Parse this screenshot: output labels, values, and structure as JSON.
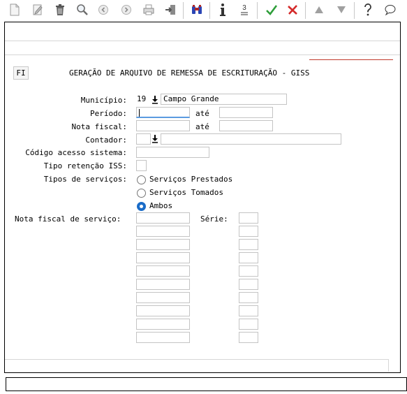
{
  "toolbar": {
    "icons": [
      "new-icon",
      "edit-icon",
      "trash-icon",
      "search-icon",
      "previous-icon",
      "next-icon",
      "print-icon",
      "exit-icon",
      "binoculars-icon",
      "info-icon",
      "list-number-icon",
      "confirm-icon",
      "cancel-icon",
      "first-icon",
      "last-icon",
      "help-icon",
      "chat-icon"
    ]
  },
  "form": {
    "mode": "FI",
    "title": "GERAÇÃO DE ARQUIVO DE REMESSA DE ESCRITURAÇÃO - GISS",
    "municipio_label": "Município:",
    "municipio_code": "19",
    "municipio_name": "Campo Grande",
    "periodo_label": "Período:",
    "periodo_from": "",
    "periodo_to": "",
    "ate_label": "até",
    "nota_label": "Nota fiscal:",
    "nota_from": "",
    "nota_to": "",
    "contador_label": "Contador:",
    "contador_code": "",
    "contador_name": "",
    "codigo_label": "Código acesso sistema:",
    "codigo_value": "",
    "retencao_label": "Tipo retenção ISS:",
    "retencao_value": "",
    "tipos_label": "Tipos de serviços:",
    "tipos_options": [
      "Serviços Prestados",
      "Serviços Tomados",
      "Ambos"
    ],
    "tipos_selected": "Ambos",
    "nfs_label": "Nota fiscal de serviço:",
    "serie_label": "Série:",
    "nfs_rows": [
      "",
      "",
      "",
      "",
      "",
      "",
      "",
      "",
      "",
      ""
    ],
    "serie_rows": [
      "",
      "",
      "",
      "",
      "",
      "",
      "",
      "",
      "",
      ""
    ]
  },
  "colors": {
    "accent": "#1a6cc8",
    "divider": "#c0392b",
    "confirm": "#2e9e3a",
    "cancel": "#d42a2a"
  }
}
